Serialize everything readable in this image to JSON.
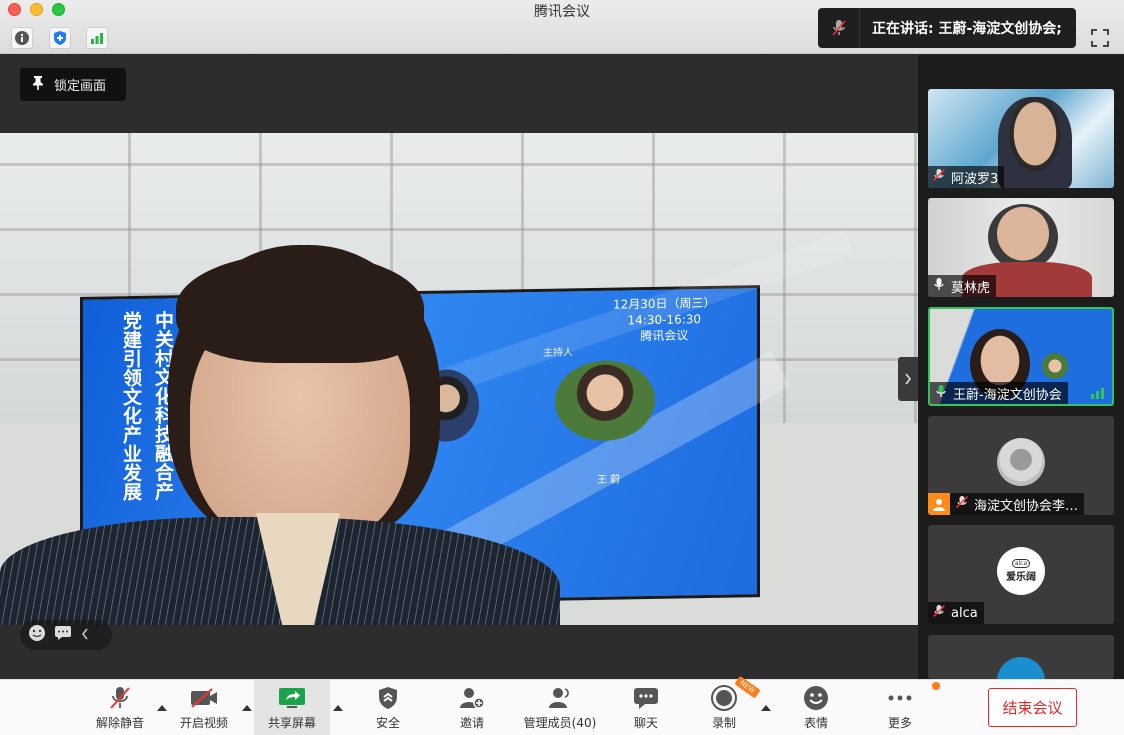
{
  "window": {
    "title": "腾讯会议"
  },
  "speaking": {
    "text": "正在讲话: 王蔚-海淀文创协会;"
  },
  "stage": {
    "pin_label": "锁定画面",
    "screen": {
      "title_vertical_1": "党建引领文化产业发展",
      "title_vertical_2": "中关村文化科技融合产",
      "date": "12月30日（周三）",
      "time": "14:30-16:30",
      "venue": "腾讯会议",
      "host_label": "主持人",
      "host_name": "王 蔚"
    }
  },
  "participants": [
    {
      "name": "阿波罗3",
      "mic": "muted"
    },
    {
      "name": "莫林虎",
      "mic": "on"
    },
    {
      "name": "王蔚-海淀文创协会",
      "mic": "on",
      "active": true
    },
    {
      "name": "海淀文创协会李…",
      "mic": "muted"
    },
    {
      "name": "alca",
      "mic": "muted",
      "avatar_text": "爱乐阔",
      "avatar_sub": "alca"
    }
  ],
  "toolbar": {
    "unmute": "解除静音",
    "start_video": "开启视频",
    "share_screen": "共享屏幕",
    "security": "安全",
    "invite": "邀请",
    "manage_members": "管理成员(40)",
    "chat": "聊天",
    "record": "录制",
    "record_badge": "NEW",
    "reactions": "表情",
    "more": "更多",
    "end_meeting": "结束会议"
  },
  "colors": {
    "active_border": "#32c35a",
    "end_button": "#e12a2a",
    "badge": "#ff7a1a"
  }
}
